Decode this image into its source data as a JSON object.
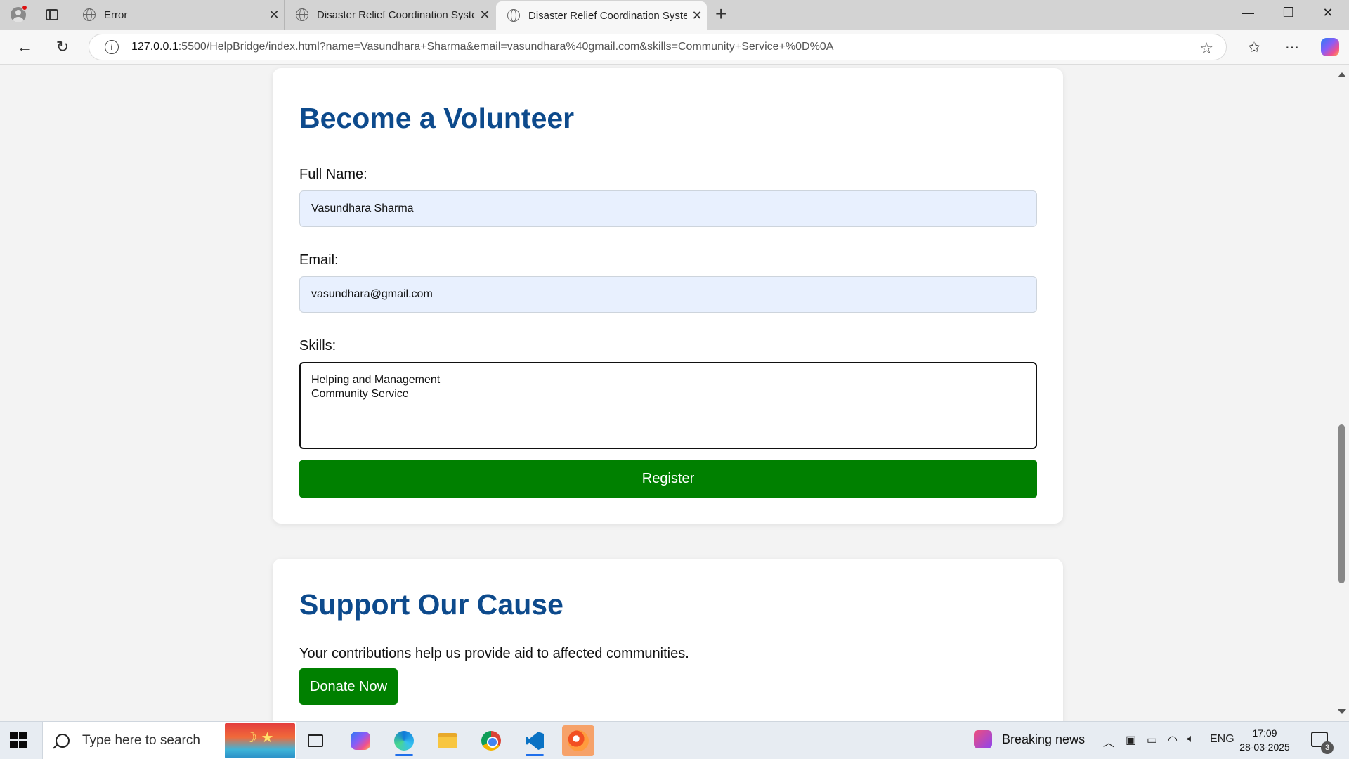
{
  "browser": {
    "tabs": [
      {
        "title": "Error",
        "active": false
      },
      {
        "title": "Disaster Relief Coordination Syste",
        "active": false
      },
      {
        "title": "Disaster Relief Coordination Syste",
        "active": true
      }
    ],
    "url_host": "127.0.0.1",
    "url_rest": ":5500/HelpBridge/index.html?name=Vasundhara+Sharma&email=vasundhara%40gmail.com&skills=Community+Service+%0D%0A"
  },
  "volunteer": {
    "heading": "Become a Volunteer",
    "name_label": "Full Name:",
    "name_value": "Vasundhara Sharma",
    "email_label": "Email:",
    "email_value": "vasundhara@gmail.com",
    "skills_label": "Skills:",
    "skills_value": "Helping and Management\nCommunity Service",
    "register_label": "Register"
  },
  "cause": {
    "heading": "Support Our Cause",
    "text": "Your contributions help us provide aid to affected communities.",
    "donate_label": "Donate Now"
  },
  "taskbar": {
    "search_placeholder": "Type here to search",
    "news": "Breaking news",
    "lang": "ENG",
    "time": "17:09",
    "date": "28-03-2025",
    "notif_count": "3"
  },
  "colors": {
    "heading": "#0d4a8c",
    "button": "#008000",
    "input_bg": "#e8f0fe"
  }
}
